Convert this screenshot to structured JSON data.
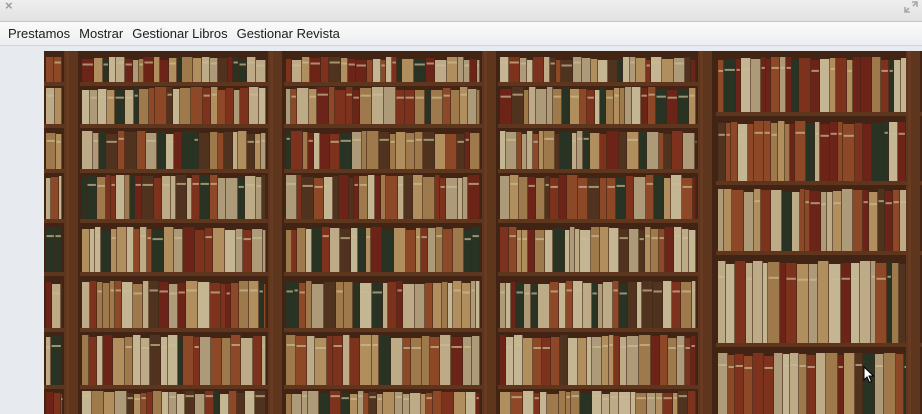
{
  "window": {
    "close_glyph": "×",
    "close_icon": "close-icon",
    "resize_icon": "resize-icon"
  },
  "menubar": {
    "items": [
      {
        "label": "Prestamos"
      },
      {
        "label": "Mostrar"
      },
      {
        "label": "Gestionar Libros"
      },
      {
        "label": "Gestionar Revista"
      }
    ]
  },
  "banner": {
    "image": "bookshelf-image",
    "colors": {
      "wood": "#4a2a17",
      "shelf": "#6b3d22",
      "book_palette": [
        "#c9a26b",
        "#b48a56",
        "#8f3a22",
        "#2f3b2a",
        "#d8c39a",
        "#a0522d",
        "#5a3b24",
        "#c5b08a",
        "#7b2a1c",
        "#e0cfa8"
      ]
    }
  },
  "cursor": {
    "icon": "mouse-pointer-icon"
  }
}
